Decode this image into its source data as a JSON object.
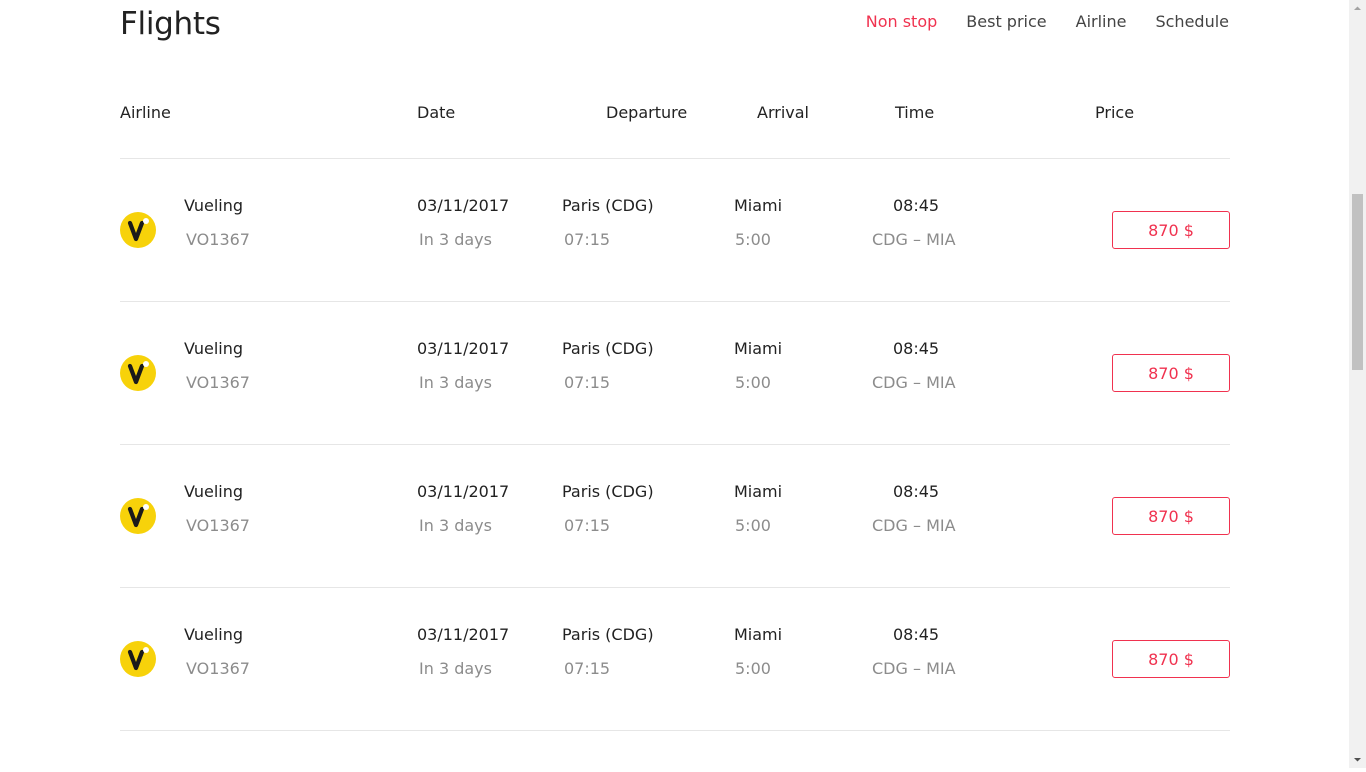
{
  "page": {
    "title": "Flights"
  },
  "filters": [
    {
      "label": "Non stop",
      "active": true
    },
    {
      "label": "Best price",
      "active": false
    },
    {
      "label": "Airline",
      "active": false
    },
    {
      "label": "Schedule",
      "active": false
    }
  ],
  "table": {
    "headers": {
      "airline": "Airline",
      "date": "Date",
      "departure": "Departure",
      "arrival": "Arrival",
      "time": "Time",
      "price": "Price"
    },
    "rows": [
      {
        "airline": "Vueling",
        "code": "VO1367",
        "date": "03/11/2017",
        "relative": "In 3 days",
        "from": "Paris (CDG)",
        "dep_time": "07:15",
        "to": "Miami",
        "duration": "5:00",
        "time": "08:45",
        "route": "CDG – MIA",
        "price": "870 $"
      },
      {
        "airline": "Vueling",
        "code": "VO1367",
        "date": "03/11/2017",
        "relative": "In 3 days",
        "from": "Paris (CDG)",
        "dep_time": "07:15",
        "to": "Miami",
        "duration": "5:00",
        "time": "08:45",
        "route": "CDG – MIA",
        "price": "870 $"
      },
      {
        "airline": "Vueling",
        "code": "VO1367",
        "date": "03/11/2017",
        "relative": "In 3 days",
        "from": "Paris (CDG)",
        "dep_time": "07:15",
        "to": "Miami",
        "duration": "5:00",
        "time": "08:45",
        "route": "CDG – MIA",
        "price": "870 $"
      },
      {
        "airline": "Vueling",
        "code": "VO1367",
        "date": "03/11/2017",
        "relative": "In 3 days",
        "from": "Paris (CDG)",
        "dep_time": "07:15",
        "to": "Miami",
        "duration": "5:00",
        "time": "08:45",
        "route": "CDG – MIA",
        "price": "870 $"
      }
    ]
  },
  "logo": {
    "icon": "vueling-logo-icon",
    "color": "#f7d20a"
  },
  "colors": {
    "accent": "#f0324f",
    "text": "#222222",
    "muted": "#8c8c8c",
    "divider": "#e6e6e6"
  }
}
